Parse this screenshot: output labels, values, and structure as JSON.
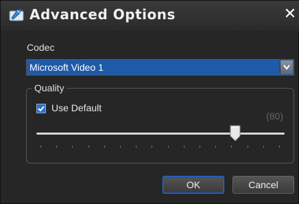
{
  "dialog": {
    "title": "Advanced Options",
    "close_label": "✕"
  },
  "codec": {
    "label": "Codec",
    "selected": "Microsoft Video 1"
  },
  "quality": {
    "group_label": "Quality",
    "use_default_label": "Use Default",
    "use_default_checked": true,
    "value_text": "(80)",
    "value": 80,
    "min": 0,
    "max": 100,
    "tick_count": 16
  },
  "buttons": {
    "ok": "OK",
    "cancel": "Cancel"
  },
  "colors": {
    "accent": "#1f5aa8",
    "background": "#262626"
  }
}
